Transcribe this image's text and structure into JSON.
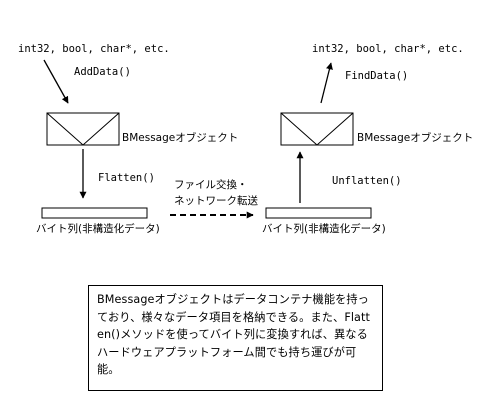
{
  "left": {
    "types": "int32, bool, char*, etc.",
    "method": "AddData()",
    "object": "BMessageオブジェクト",
    "conversion": "Flatten()",
    "bytes": "バイト列(非構造化データ)"
  },
  "right": {
    "types": "int32, bool, char*, etc.",
    "method": "FindData()",
    "object": "BMessageオブジェクト",
    "conversion": "Unflatten()",
    "bytes": "バイト列(非構造化データ)"
  },
  "transfer": {
    "line1": "ファイル交換・",
    "line2": "ネットワーク転送"
  },
  "note": {
    "text": "BMessageオブジェクトはデータコンテナ機能を持っており、様々なデータ項目を格納できる。また、Flatten()メソッドを使ってバイト列に変換すれば、異なるハードウェアプラットフォーム間でも持ち運びが可能。"
  }
}
